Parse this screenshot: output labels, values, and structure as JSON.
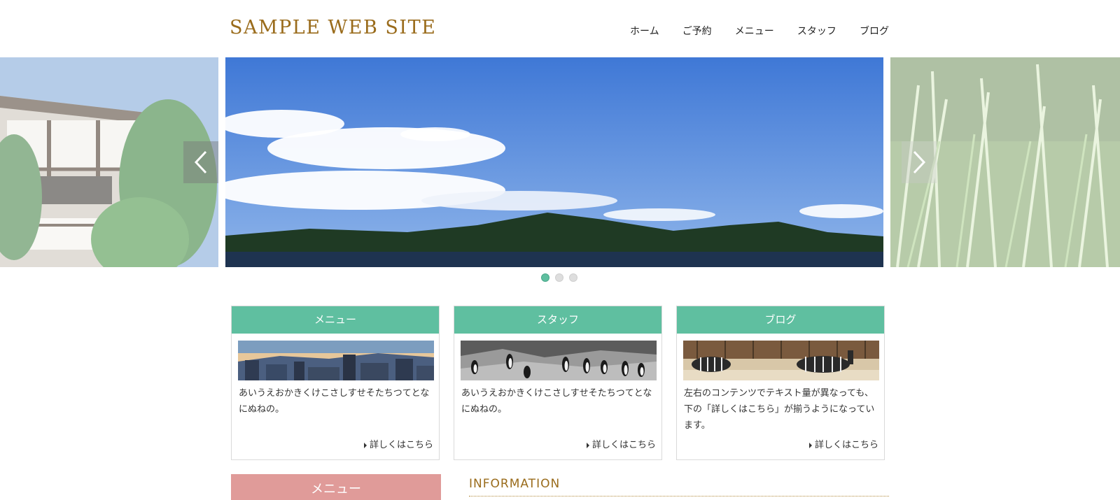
{
  "header": {
    "logo": "SAMPLE WEB SITE"
  },
  "nav": {
    "items": [
      "ホーム",
      "ご予約",
      "メニュー",
      "スタッフ",
      "ブログ"
    ]
  },
  "slider": {
    "active_index": 0,
    "dot_count": 3
  },
  "cards": [
    {
      "title": "メニュー",
      "image": "city-skyline-image",
      "text": "あいうえおかきくけこさしすせそたちつてとなにぬねの。",
      "more": "詳しくはこちら"
    },
    {
      "title": "スタッフ",
      "image": "penguins-image",
      "text": "あいうえおかきくけこさしすせそたちつてとなにぬねの。",
      "more": "詳しくはこちら"
    },
    {
      "title": "ブログ",
      "image": "zebras-image",
      "text": "左右のコンテンツでテキスト量が異なっても、下の「詳しくはこちら」が揃うようになっています。",
      "more": "詳しくはこちら"
    }
  ],
  "sidebar": {
    "title": "メニュー"
  },
  "info": {
    "title": "INFORMATION"
  },
  "colors": {
    "accent": "#5fbfa0",
    "brand": "#9a6c1c",
    "side": "#e09b99"
  }
}
